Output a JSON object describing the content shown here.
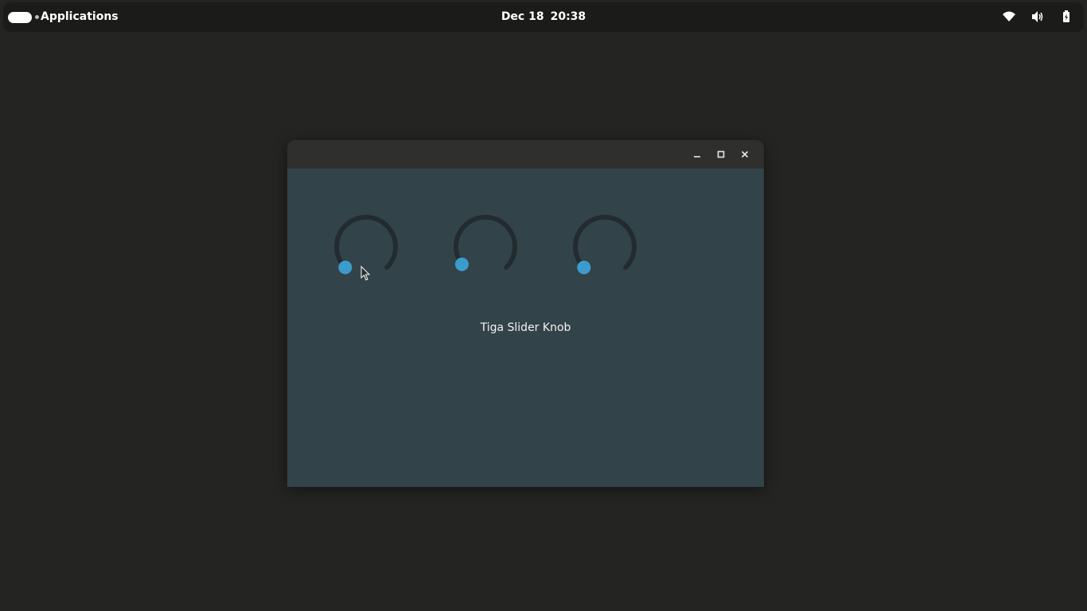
{
  "topbar": {
    "applications_label": "Applications",
    "date": "Dec 18",
    "time": "20:38",
    "tray": [
      "wifi-icon",
      "volume-icon",
      "battery-icon"
    ]
  },
  "window": {
    "buttons": [
      "minimize-icon",
      "maximize-icon",
      "close-icon"
    ],
    "caption": "Tiga Slider Knob",
    "knobs": [
      {
        "value": 0.0
      },
      {
        "value": 0.03
      },
      {
        "value": 0.0
      }
    ],
    "colors": {
      "track": "#222b30",
      "handle": "#3b9ccc",
      "background": "#33434a"
    }
  }
}
